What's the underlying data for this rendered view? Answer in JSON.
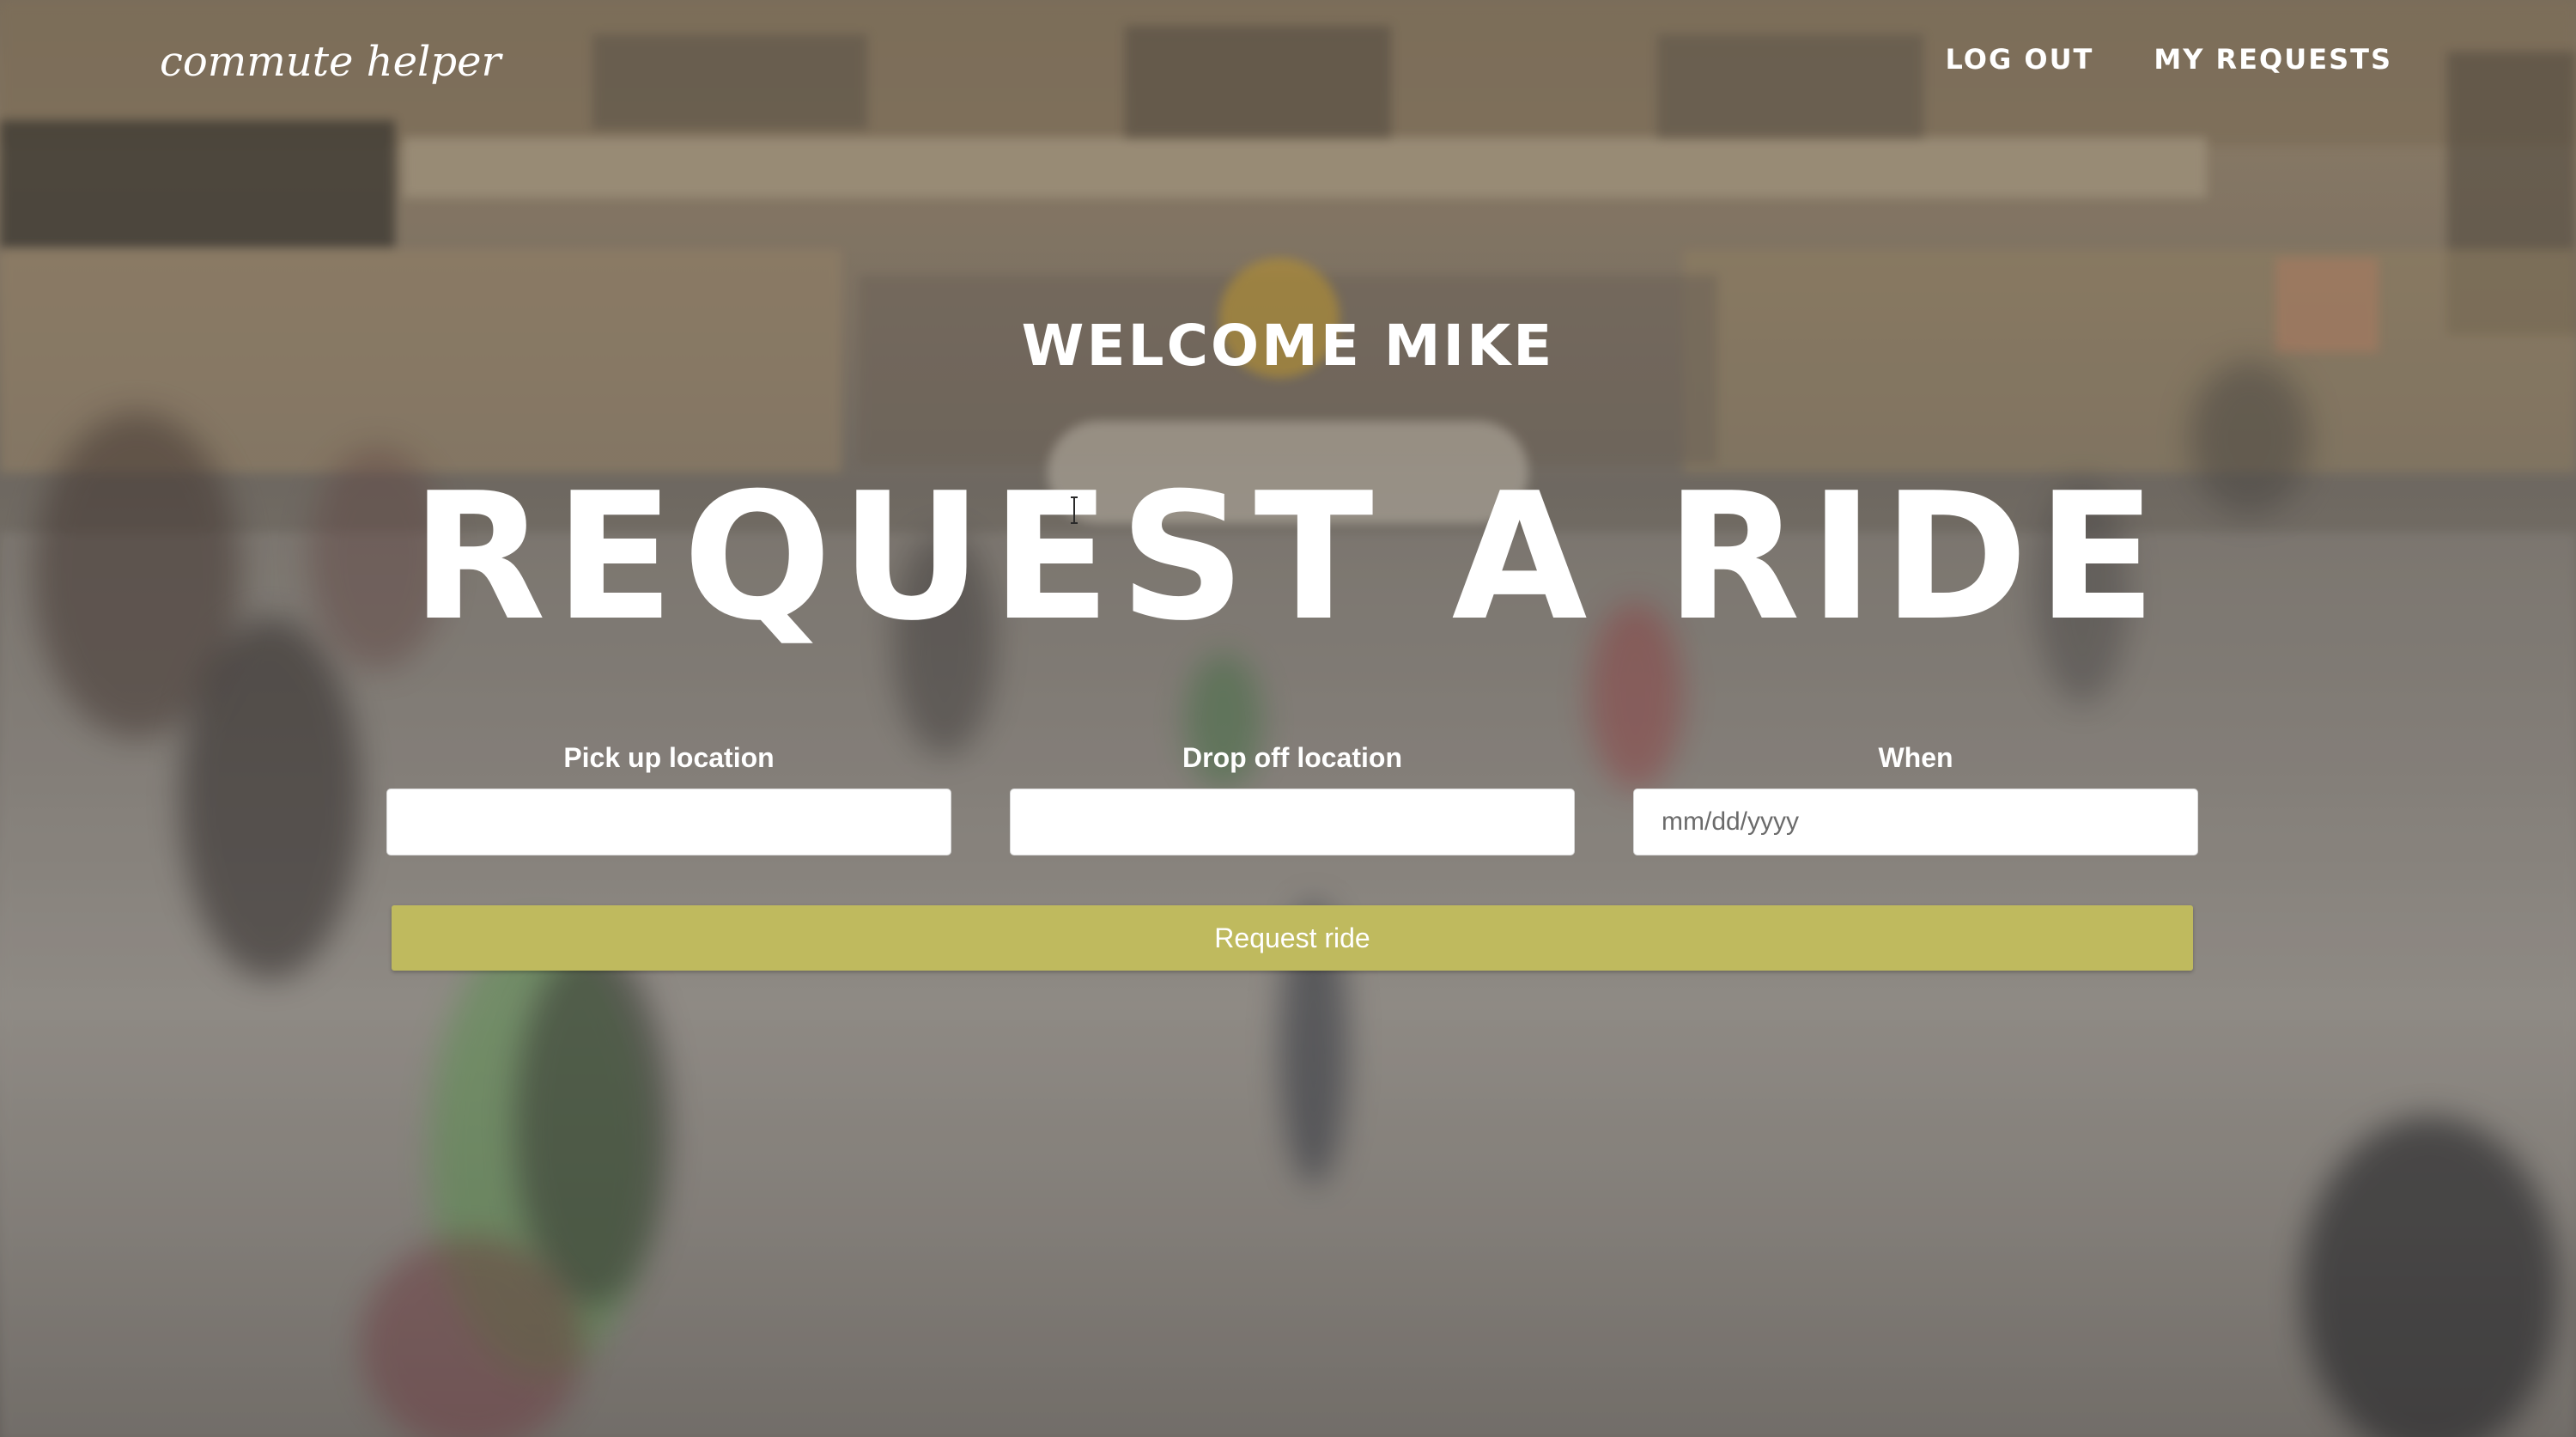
{
  "header": {
    "logo": "commute helper",
    "nav": [
      {
        "label": "LOG OUT"
      },
      {
        "label": "MY REQUESTS"
      }
    ]
  },
  "hero": {
    "welcome": "WELCOME MIKE",
    "title": "REQUEST A RIDE"
  },
  "form": {
    "pickup": {
      "label": "Pick up location",
      "value": "",
      "placeholder": ""
    },
    "dropoff": {
      "label": "Drop off location",
      "value": "",
      "placeholder": ""
    },
    "when": {
      "label": "When",
      "value": "",
      "placeholder": "mm/dd/yyyy"
    },
    "submit_label": "Request ride"
  },
  "colors": {
    "accent": "#bfba5e",
    "text": "#ffffff"
  },
  "icons": {
    "cursor": "text-cursor-icon"
  }
}
